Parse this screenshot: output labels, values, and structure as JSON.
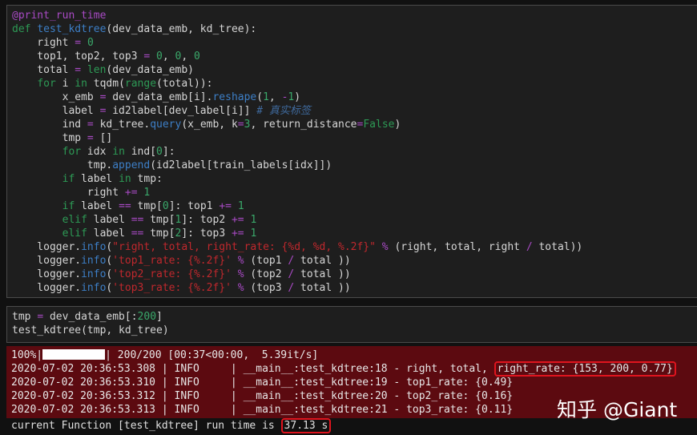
{
  "code_cell": {
    "lines": [
      [
        [
          "deco",
          "@print_run_time"
        ]
      ],
      [
        [
          "kw",
          "def "
        ],
        [
          "fn",
          "test_kdtree"
        ],
        [
          "t",
          "(dev_data_emb, kd_tree):"
        ]
      ],
      [
        [
          "t",
          "    right "
        ],
        [
          "op",
          "="
        ],
        [
          "t",
          " "
        ],
        [
          "num",
          "0"
        ]
      ],
      [
        [
          "t",
          "    top1, top2, top3 "
        ],
        [
          "op",
          "="
        ],
        [
          "t",
          " "
        ],
        [
          "num",
          "0"
        ],
        [
          "t",
          ", "
        ],
        [
          "num",
          "0"
        ],
        [
          "t",
          ", "
        ],
        [
          "num",
          "0"
        ]
      ],
      [
        [
          "t",
          "    total "
        ],
        [
          "op",
          "="
        ],
        [
          "t",
          " "
        ],
        [
          "bi",
          "len"
        ],
        [
          "t",
          "(dev_data_emb)"
        ]
      ],
      [
        [
          "t",
          "    "
        ],
        [
          "kw",
          "for"
        ],
        [
          "t",
          " i "
        ],
        [
          "kw",
          "in"
        ],
        [
          "t",
          " tqdm("
        ],
        [
          "bi",
          "range"
        ],
        [
          "t",
          "(total)):"
        ]
      ],
      [
        [
          "t",
          "        x_emb "
        ],
        [
          "op",
          "="
        ],
        [
          "t",
          " dev_data_emb[i]."
        ],
        [
          "fn",
          "reshape"
        ],
        [
          "t",
          "("
        ],
        [
          "num",
          "1"
        ],
        [
          "t",
          ", "
        ],
        [
          "op",
          "-"
        ],
        [
          "num",
          "1"
        ],
        [
          "t",
          ")"
        ]
      ],
      [
        [
          "t",
          "        label "
        ],
        [
          "op",
          "="
        ],
        [
          "t",
          " id2label[dev_label[i]] "
        ],
        [
          "cm",
          "# 真实标签"
        ]
      ],
      [
        [
          "t",
          "        ind "
        ],
        [
          "op",
          "="
        ],
        [
          "t",
          " kd_tree."
        ],
        [
          "fn",
          "query"
        ],
        [
          "t",
          "(x_emb, k"
        ],
        [
          "op",
          "="
        ],
        [
          "num",
          "3"
        ],
        [
          "t",
          ", return_distance"
        ],
        [
          "op",
          "="
        ],
        [
          "kw",
          "False"
        ],
        [
          "t",
          ")"
        ]
      ],
      [
        [
          "t",
          "        tmp "
        ],
        [
          "op",
          "="
        ],
        [
          "t",
          " []"
        ]
      ],
      [
        [
          "t",
          "        "
        ],
        [
          "kw",
          "for"
        ],
        [
          "t",
          " idx "
        ],
        [
          "kw",
          "in"
        ],
        [
          "t",
          " ind["
        ],
        [
          "num",
          "0"
        ],
        [
          "t",
          "]:"
        ]
      ],
      [
        [
          "t",
          "            tmp."
        ],
        [
          "fn",
          "append"
        ],
        [
          "t",
          "(id2label[train_labels[idx]])"
        ]
      ],
      [
        [
          "t",
          "        "
        ],
        [
          "kw",
          "if"
        ],
        [
          "t",
          " label "
        ],
        [
          "kw",
          "in"
        ],
        [
          "t",
          " tmp:"
        ]
      ],
      [
        [
          "t",
          "            right "
        ],
        [
          "op",
          "+="
        ],
        [
          "t",
          " "
        ],
        [
          "num",
          "1"
        ]
      ],
      [
        [
          "t",
          "        "
        ],
        [
          "kw",
          "if"
        ],
        [
          "t",
          " label "
        ],
        [
          "op",
          "=="
        ],
        [
          "t",
          " tmp["
        ],
        [
          "num",
          "0"
        ],
        [
          "t",
          "]: top1 "
        ],
        [
          "op",
          "+="
        ],
        [
          "t",
          " "
        ],
        [
          "num",
          "1"
        ]
      ],
      [
        [
          "t",
          "        "
        ],
        [
          "kw",
          "elif"
        ],
        [
          "t",
          " label "
        ],
        [
          "op",
          "=="
        ],
        [
          "t",
          " tmp["
        ],
        [
          "num",
          "1"
        ],
        [
          "t",
          "]: top2 "
        ],
        [
          "op",
          "+="
        ],
        [
          "t",
          " "
        ],
        [
          "num",
          "1"
        ]
      ],
      [
        [
          "t",
          "        "
        ],
        [
          "kw",
          "elif"
        ],
        [
          "t",
          " label "
        ],
        [
          "op",
          "=="
        ],
        [
          "t",
          " tmp["
        ],
        [
          "num",
          "2"
        ],
        [
          "t",
          "]: top3 "
        ],
        [
          "op",
          "+="
        ],
        [
          "t",
          " "
        ],
        [
          "num",
          "1"
        ]
      ],
      [
        [
          "t",
          "    logger."
        ],
        [
          "fn",
          "info"
        ],
        [
          "t",
          "("
        ],
        [
          "str",
          "\"right, total, right_rate: {%d, %d, %.2f}\""
        ],
        [
          "t",
          " "
        ],
        [
          "op",
          "%"
        ],
        [
          "t",
          " (right, total, right "
        ],
        [
          "op",
          "/"
        ],
        [
          "t",
          " total))"
        ]
      ],
      [
        [
          "t",
          "    logger."
        ],
        [
          "fn",
          "info"
        ],
        [
          "t",
          "("
        ],
        [
          "str",
          "'top1_rate: {%.2f}'"
        ],
        [
          "t",
          " "
        ],
        [
          "op",
          "%"
        ],
        [
          "t",
          " (top1 "
        ],
        [
          "op",
          "/"
        ],
        [
          "t",
          " total ))"
        ]
      ],
      [
        [
          "t",
          "    logger."
        ],
        [
          "fn",
          "info"
        ],
        [
          "t",
          "("
        ],
        [
          "str",
          "'top2_rate: {%.2f}'"
        ],
        [
          "t",
          " "
        ],
        [
          "op",
          "%"
        ],
        [
          "t",
          " (top2 "
        ],
        [
          "op",
          "/"
        ],
        [
          "t",
          " total ))"
        ]
      ],
      [
        [
          "t",
          "    logger."
        ],
        [
          "fn",
          "info"
        ],
        [
          "t",
          "("
        ],
        [
          "str",
          "'top3_rate: {%.2f}'"
        ],
        [
          "t",
          " "
        ],
        [
          "op",
          "%"
        ],
        [
          "t",
          " (top3 "
        ],
        [
          "op",
          "/"
        ],
        [
          "t",
          " total ))"
        ]
      ]
    ]
  },
  "call_cell": {
    "lines": [
      [
        [
          "t",
          "tmp "
        ],
        [
          "op",
          "="
        ],
        [
          "t",
          " dev_data_emb[:"
        ],
        [
          "num",
          "200"
        ],
        [
          "t",
          "]"
        ]
      ],
      [
        [
          "t",
          "test_kdtree(tmp, kd_tree)"
        ]
      ]
    ]
  },
  "output": {
    "progress": {
      "percent_label": "100%|",
      "fraction": 1.0,
      "rest": "| 200/200 [00:37<00:00,  5.39it/s]"
    },
    "logs": [
      {
        "text": "2020-07-02 20:36:53.308 | INFO     | __main__:test_kdtree:18 - right, total, ",
        "highlight": "right_rate: {153, 200, 0.77}"
      },
      {
        "text": "2020-07-02 20:36:53.310 | INFO     | __main__:test_kdtree:19 - top1_rate: {0.49}",
        "highlight": null
      },
      {
        "text": "2020-07-02 20:36:53.312 | INFO     | __main__:test_kdtree:20 - top2_rate: {0.16}",
        "highlight": null
      },
      {
        "text": "2020-07-02 20:36:53.313 | INFO     | __main__:test_kdtree:21 - top3_rate: {0.11}",
        "highlight": null
      }
    ],
    "runtime_prefix": "current Function [test_kdtree] run time is ",
    "runtime_value": "37.13 s"
  },
  "watermark": "知乎 @Giant",
  "colors": {
    "output_bg": "#5c0a10",
    "highlight_border": "#e0141e"
  }
}
